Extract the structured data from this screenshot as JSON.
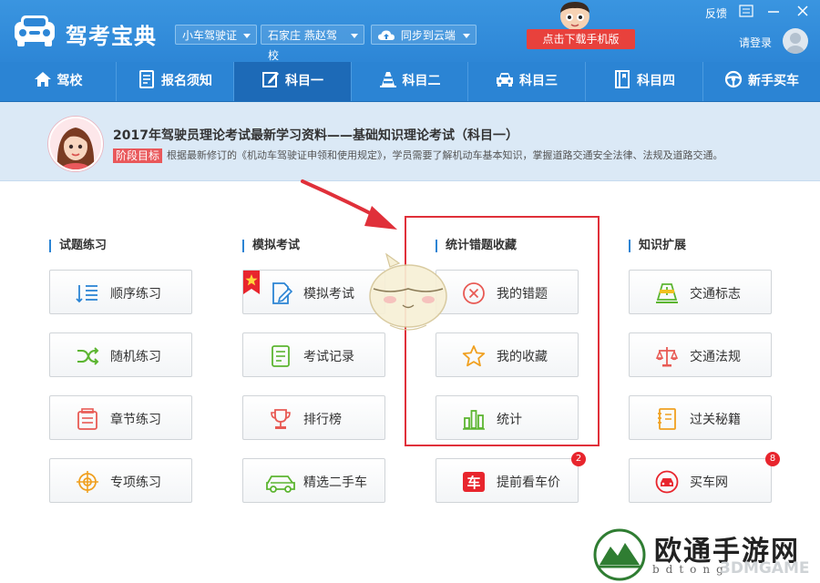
{
  "header": {
    "app_title": "驾考宝典",
    "vehicle_select": "小车驾驶证",
    "school_select": "石家庄 燕赵驾校",
    "sync_label": "同步到云端",
    "download_btn": "点击下载手机版",
    "feedback": "反馈",
    "login": "请登录"
  },
  "nav": {
    "items": [
      {
        "label": "驾校",
        "icon": "home-icon"
      },
      {
        "label": "报名须知",
        "icon": "document-icon"
      },
      {
        "label": "科目一",
        "icon": "edit-icon",
        "active": true
      },
      {
        "label": "科目二",
        "icon": "traffic-cone-icon"
      },
      {
        "label": "科目三",
        "icon": "car-icon"
      },
      {
        "label": "科目四",
        "icon": "book-icon"
      },
      {
        "label": "新手买车",
        "icon": "steering-wheel-icon"
      }
    ]
  },
  "banner": {
    "title": "2017年驾驶员理论考试最新学习资料——基础知识理论考试（科目一）",
    "stage_tag": "阶段目标",
    "description": "根据最新修订的《机动车驾驶证申领和使用规定》，学员需要了解机动车基本知识，掌握道路交通安全法律、法规及道路交通。"
  },
  "sections": [
    {
      "title": "试题练习",
      "buttons": [
        {
          "label": "顺序练习",
          "icon": "list-order-icon"
        },
        {
          "label": "随机练习",
          "icon": "shuffle-icon"
        },
        {
          "label": "章节练习",
          "icon": "chapter-icon"
        },
        {
          "label": "专项练习",
          "icon": "target-icon"
        }
      ]
    },
    {
      "title": "模拟考试",
      "buttons": [
        {
          "label": "模拟考试",
          "icon": "exam-pen-icon"
        },
        {
          "label": "考试记录",
          "icon": "record-icon"
        },
        {
          "label": "排行榜",
          "icon": "trophy-icon"
        },
        {
          "label": "精选二手车",
          "icon": "used-car-icon"
        }
      ]
    },
    {
      "title": "统计错题收藏",
      "buttons": [
        {
          "label": "我的错题",
          "icon": "wrong-x-icon"
        },
        {
          "label": "我的收藏",
          "icon": "star-icon"
        },
        {
          "label": "统计",
          "icon": "bar-chart-icon"
        },
        {
          "label": "提前看车价",
          "icon": "car-price-icon",
          "badge": "2"
        }
      ]
    },
    {
      "title": "知识扩展",
      "buttons": [
        {
          "label": "交通标志",
          "icon": "road-sign-icon"
        },
        {
          "label": "交通法规",
          "icon": "scales-icon"
        },
        {
          "label": "过关秘籍",
          "icon": "notebook-icon"
        },
        {
          "label": "买车网",
          "icon": "buy-car-icon",
          "badge": "8"
        }
      ]
    }
  ],
  "watermark": {
    "text": "欧通手游网",
    "sub": "bdtong",
    "brand": "3DMGAME"
  },
  "colors": {
    "header_blue": "#2d86d6",
    "nav_active": "#1d6ab7",
    "download_red": "#e8413c",
    "highlight_red": "#e0303a",
    "icon_blue": "#2b84d4",
    "icon_green": "#5cb531",
    "icon_red": "#e85a54",
    "icon_orange": "#f0a020"
  }
}
